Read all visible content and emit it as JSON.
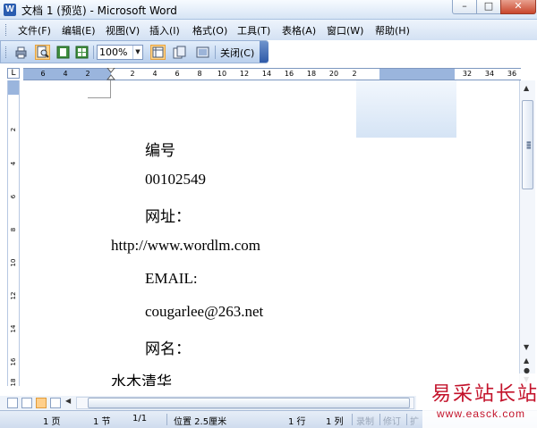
{
  "window": {
    "app_icon_glyph": "W",
    "title": "文档 1 (预览) - Microsoft Word"
  },
  "menu": [
    "文件(F)",
    "编辑(E)",
    "视图(V)",
    "插入(I)",
    "格式(O)",
    "工具(T)",
    "表格(A)",
    "窗口(W)",
    "帮助(H)"
  ],
  "toolbar": {
    "zoom_value": "100%",
    "close_label": "关闭(C)",
    "icons": [
      "print-icon",
      "magnifier-icon",
      "single-page-icon",
      "multiple-pages-icon",
      "view-ruler-icon",
      "shrink-to-fit-icon",
      "full-screen-icon"
    ]
  },
  "ruler": {
    "corner_glyph": "L",
    "h_numbers": [
      "6",
      "4",
      "2",
      "2",
      "4",
      "6",
      "8",
      "10",
      "12",
      "14",
      "16",
      "18",
      "20",
      "2",
      "32",
      "34",
      "36"
    ],
    "v_numbers": [
      "2",
      "4",
      "6",
      "8",
      "10",
      "12",
      "14",
      "16",
      "18"
    ]
  },
  "document": {
    "lines": [
      "编号",
      "00102549",
      "网址：",
      "http://www.wordlm.com",
      "EMAIL:",
      "cougarlee@263.net",
      "网名：",
      "水木清华"
    ]
  },
  "status": {
    "page": "1 页",
    "section": "1 节",
    "page_of": "1/1",
    "position": "位置 2.5厘米",
    "line": "1 行",
    "column": "1 列",
    "rec": "录制",
    "trk": "修订",
    "ext": "扩"
  },
  "watermark": {
    "text": "易采站长站",
    "url": "www.easck.com"
  }
}
